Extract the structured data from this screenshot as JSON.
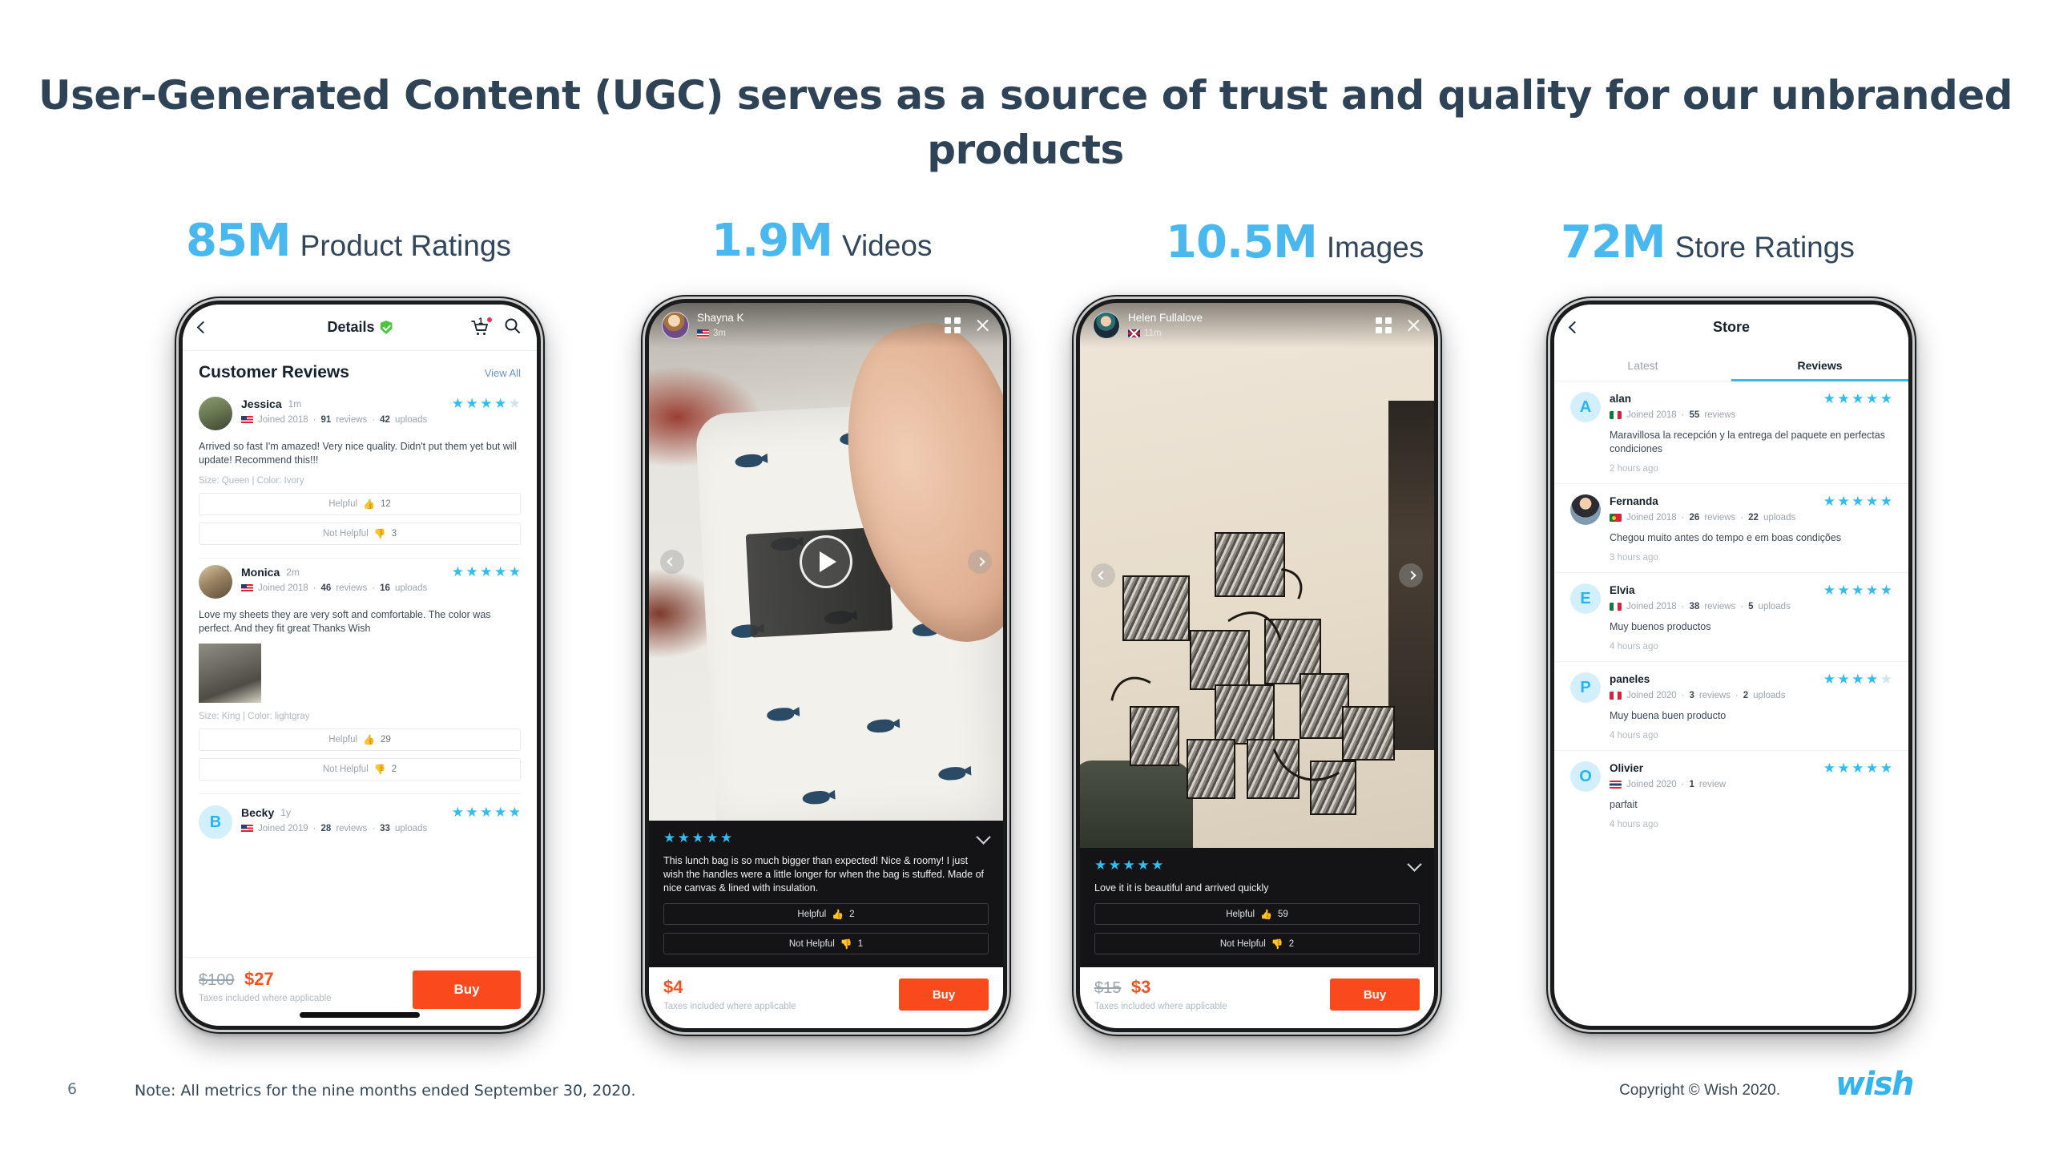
{
  "slide": {
    "title": "User-Generated Content (UGC) serves as a source of trust and quality for our unbranded products",
    "page_number": "6",
    "note": "Note: All metrics for the nine months ended September 30, 2020.",
    "copyright": "Copyright © Wish 2020.",
    "logo": "wish",
    "accent_blue": "#49b8ef",
    "title_color": "#2e4356",
    "buy_orange": "#f9491d",
    "star_blue": "#31bdf2"
  },
  "metrics": [
    {
      "value": "85M",
      "label": "Product Ratings"
    },
    {
      "value": "1.9M",
      "label": "Videos"
    },
    {
      "value": "10.5M",
      "label": "Images"
    },
    {
      "value": "72M",
      "label": "Store Ratings"
    }
  ],
  "phone_product": {
    "nav": {
      "title": "Details",
      "back_icon": "chevron-left-icon",
      "verified_icon": "shield-check-icon",
      "cart_icon": "cart-icon",
      "cart_count": "1",
      "search_icon": "search-icon"
    },
    "section": {
      "heading": "Customer Reviews",
      "view_all": "View All"
    },
    "reviews": [
      {
        "name": "Jessica",
        "age": "1m",
        "stars_filled": 4,
        "stars_total": 5,
        "joined": "Joined 2018",
        "reviews": "91",
        "reviews_word": "reviews",
        "uploads": "42",
        "uploads_word": "uploads",
        "flag": "us",
        "body": "Arrived so fast I'm amazed! Very nice quality. Didn't put them yet but will update! Recommend this!!!",
        "attrs": "Size: Queen  |  Color: Ivory",
        "helpful_label": "Helpful",
        "helpful_count": "12",
        "not_helpful_label": "Not Helpful",
        "not_helpful_count": "3",
        "has_photo": false
      },
      {
        "name": "Monica",
        "age": "2m",
        "stars_filled": 5,
        "stars_total": 5,
        "joined": "Joined 2018",
        "reviews": "46",
        "reviews_word": "reviews",
        "uploads": "16",
        "uploads_word": "uploads",
        "flag": "us",
        "body": "Love my sheets they are very soft and comfortable. The color was perfect. And they fit great Thanks Wish",
        "attrs": "Size: King  |  Color: lightgray",
        "helpful_label": "Helpful",
        "helpful_count": "29",
        "not_helpful_label": "Not Helpful",
        "not_helpful_count": "2",
        "has_photo": true
      },
      {
        "name": "Becky",
        "age": "1y",
        "stars_filled": 5,
        "stars_total": 5,
        "joined": "Joined 2019",
        "reviews": "28",
        "reviews_word": "reviews",
        "uploads": "33",
        "uploads_word": "uploads",
        "flag": "us",
        "body": "",
        "attrs": "",
        "helpful_label": "",
        "helpful_count": "",
        "not_helpful_label": "",
        "not_helpful_count": "",
        "has_photo": false
      }
    ],
    "footer": {
      "price_old": "$100",
      "price_new": "$27",
      "tax_note": "Taxes included where applicable",
      "buy_label": "Buy"
    }
  },
  "phone_video": {
    "header": {
      "user": "Shayna K",
      "age": "3m",
      "flag": "us",
      "grid_icon": "grid-icon",
      "close_icon": "close-icon"
    },
    "overlay": {
      "play_icon": "play-icon",
      "prev_icon": "chevron-left-icon",
      "next_icon": "chevron-right-icon"
    },
    "review": {
      "stars_filled": 5,
      "stars_total": 5,
      "collapse_icon": "chevron-down-icon",
      "body": "This lunch bag is so much bigger than expected! Nice & roomy! I just wish the handles were a little longer for when the bag is stuffed. Made of nice canvas & lined with insulation.",
      "helpful_label": "Helpful",
      "helpful_count": "2",
      "not_helpful_label": "Not Helpful",
      "not_helpful_count": "1"
    },
    "footer": {
      "price_old": "",
      "price_new": "$4",
      "tax_note": "Taxes included where applicable",
      "buy_label": "Buy"
    }
  },
  "phone_image": {
    "header": {
      "user": "Helen Fullalove",
      "age": "11m",
      "flag": "uk",
      "grid_icon": "grid-icon",
      "close_icon": "close-icon"
    },
    "overlay": {
      "prev_icon": "chevron-left-icon",
      "next_icon": "chevron-right-icon"
    },
    "review": {
      "stars_filled": 5,
      "stars_total": 5,
      "collapse_icon": "chevron-down-icon",
      "body": "Love it it is beautiful and arrived quickly",
      "helpful_label": "Helpful",
      "helpful_count": "59",
      "not_helpful_label": "Not Helpful",
      "not_helpful_count": "2"
    },
    "footer": {
      "price_old": "$15",
      "price_new": "$3",
      "tax_note": "Taxes included where applicable",
      "buy_label": "Buy"
    }
  },
  "phone_store": {
    "nav": {
      "title": "Store",
      "back_icon": "chevron-left-icon"
    },
    "tabs": [
      {
        "label": "Latest",
        "active": false
      },
      {
        "label": "Reviews",
        "active": true
      }
    ],
    "reviews": [
      {
        "name": "alan",
        "initial": "A",
        "avatar_type": "letter",
        "stars_filled": 5,
        "stars_total": 5,
        "flag": "mx",
        "joined": "Joined 2018",
        "reviews": "55",
        "reviews_word": "reviews",
        "uploads": "",
        "uploads_word": "",
        "body": "Maravillosa la recepción y la entrega del paquete en perfectas condiciones",
        "time": "2 hours ago"
      },
      {
        "name": "Fernanda",
        "initial": "F",
        "avatar_type": "photo",
        "stars_filled": 5,
        "stars_total": 5,
        "flag": "pt",
        "joined": "Joined 2018",
        "reviews": "26",
        "reviews_word": "reviews",
        "uploads": "22",
        "uploads_word": "uploads",
        "body": "Chegou muito antes do tempo e em boas condições",
        "time": "3 hours ago"
      },
      {
        "name": "Elvia",
        "initial": "E",
        "avatar_type": "letter",
        "stars_filled": 5,
        "stars_total": 5,
        "flag": "mx",
        "joined": "Joined 2018",
        "reviews": "38",
        "reviews_word": "reviews",
        "uploads": "5",
        "uploads_word": "uploads",
        "body": "Muy buenos productos",
        "time": "4 hours ago"
      },
      {
        "name": "paneles",
        "initial": "P",
        "avatar_type": "letter",
        "stars_filled": 4,
        "stars_total": 5,
        "flag": "pe",
        "joined": "Joined 2020",
        "reviews": "3",
        "reviews_word": "reviews",
        "uploads": "2",
        "uploads_word": "uploads",
        "body": "Muy buena buen producto",
        "time": "4 hours ago"
      },
      {
        "name": "Olivier",
        "initial": "O",
        "avatar_type": "letter",
        "stars_filled": 5,
        "stars_total": 5,
        "flag": "th",
        "joined": "Joined 2020",
        "reviews": "1",
        "reviews_word": "review",
        "uploads": "",
        "uploads_word": "",
        "body": "parfait",
        "time": "4 hours ago"
      }
    ]
  }
}
